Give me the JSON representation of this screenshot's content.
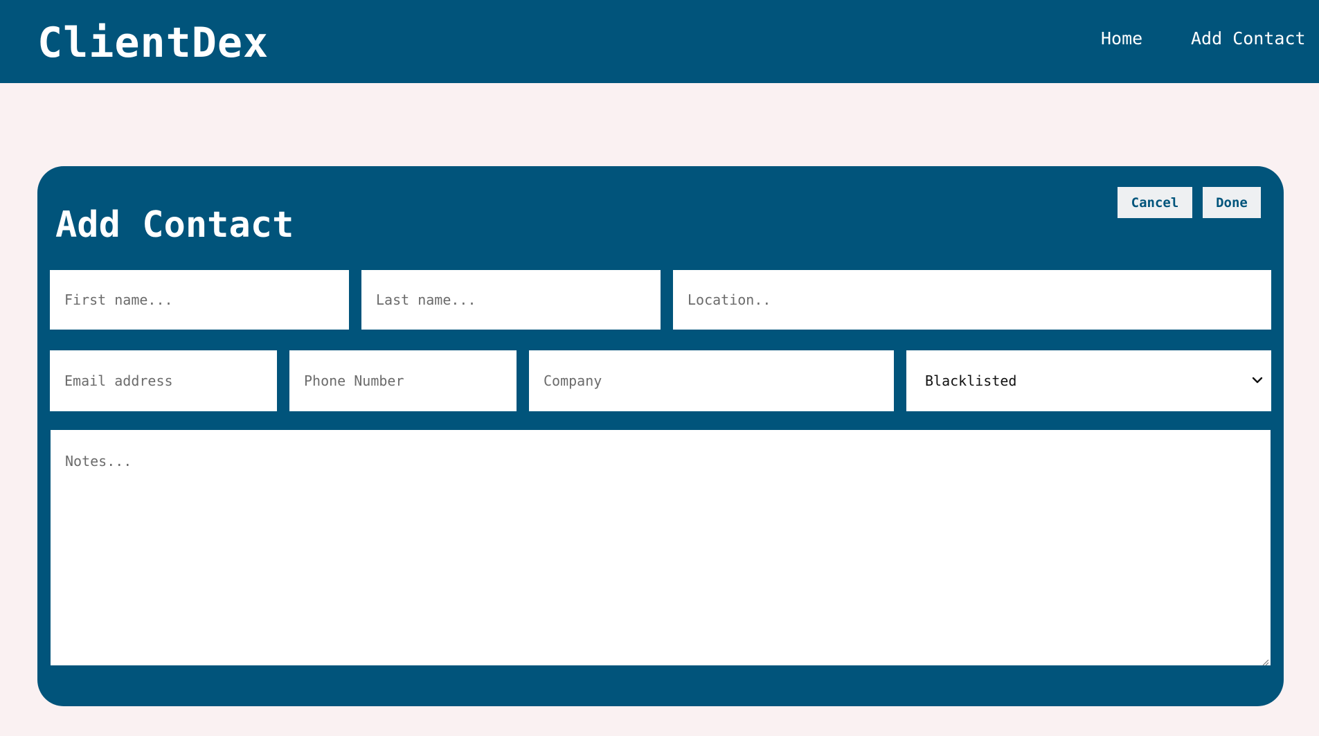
{
  "app": {
    "brand": "ClientDex"
  },
  "nav": {
    "home_label": "Home",
    "add_contact_label": "Add Contact"
  },
  "form": {
    "title": "Add Contact",
    "cancel_label": "Cancel",
    "done_label": "Done",
    "first_name": {
      "value": "",
      "placeholder": "First name..."
    },
    "last_name": {
      "value": "",
      "placeholder": "Last name..."
    },
    "location": {
      "value": "",
      "placeholder": "Location.."
    },
    "email": {
      "value": "",
      "placeholder": "Email address"
    },
    "phone": {
      "value": "",
      "placeholder": "Phone Number"
    },
    "company": {
      "value": "",
      "placeholder": "Company"
    },
    "status": {
      "selected": "Blacklisted"
    },
    "notes": {
      "value": "",
      "placeholder": "Notes..."
    }
  },
  "icons": {
    "dropdown": "chevron-down-icon",
    "resize": "resize-handle-icon"
  },
  "colors": {
    "primary": "#01547B",
    "background": "#FAF1F2",
    "button_bg": "#EEF0F2",
    "field_bg": "#FFFFFF",
    "text_on_primary": "#FFFFFF"
  }
}
